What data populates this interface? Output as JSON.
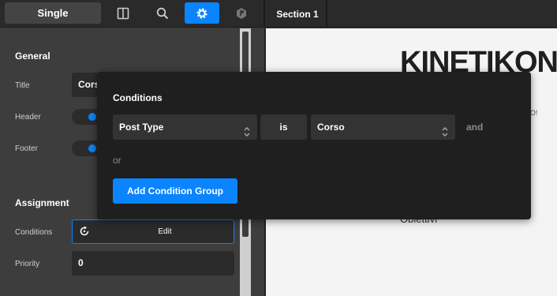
{
  "topbar": {
    "template_label": "Single",
    "section_label": "Section 1",
    "icons": [
      "layout-columns-icon",
      "search-icon",
      "gear-icon",
      "hexagon-logo-icon"
    ]
  },
  "sidebar": {
    "general_heading": "General",
    "title_label": "Title",
    "title_value": "Corso",
    "header_label": "Header",
    "footer_label": "Footer",
    "assignment_heading": "Assignment",
    "conditions_label": "Conditions",
    "conditions_edit": "Edit",
    "priority_label": "Priority",
    "priority_value": "0"
  },
  "canvas": {
    "brand": "KINETIKON",
    "nav_fragment": "O!",
    "obiettivi": "Obiettivi"
  },
  "popup": {
    "title": "Conditions",
    "field_select": "Post Type",
    "operator": "is",
    "value_select": "Corso",
    "and_label": "and",
    "or_label": "or",
    "add_group_button": "Add Condition Group"
  },
  "colors": {
    "accent": "#0a84ff",
    "panel": "#3d3d3d",
    "popup_bg": "#1f1f1f"
  }
}
